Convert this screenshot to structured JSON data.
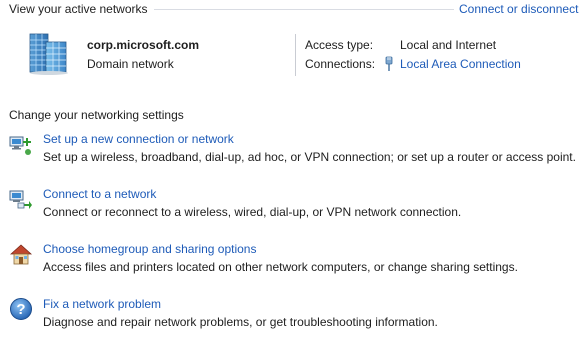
{
  "active_networks": {
    "heading": "View your active networks",
    "connect_link": "Connect or disconnect",
    "network": {
      "name": "corp.microsoft.com",
      "type": "Domain network",
      "icon": "building-network-icon"
    },
    "access_type_label": "Access type:",
    "access_type_value": "Local and Internet",
    "connections_label": "Connections:",
    "connection_link": "Local Area Connection",
    "connection_icon": "ethernet-plug-icon"
  },
  "settings": {
    "heading": "Change your networking settings",
    "tasks": [
      {
        "title": "Set up a new connection or network",
        "description": "Set up a wireless, broadband, dial-up, ad hoc, or VPN connection; or set up a router or access point.",
        "icon": "new-connection-icon"
      },
      {
        "title": "Connect to a network",
        "description": "Connect or reconnect to a wireless, wired, dial-up, or VPN network connection.",
        "icon": "connect-network-icon"
      },
      {
        "title": "Choose homegroup and sharing options",
        "description": "Access files and printers located on other network computers, or change sharing settings.",
        "icon": "homegroup-icon"
      },
      {
        "title": "Fix a network problem",
        "description": "Diagnose and repair network problems, or get troubleshooting information.",
        "icon": "help-icon"
      }
    ]
  },
  "colors": {
    "link": "#1e5bb8",
    "text": "#1e1e1e",
    "rule": "#d9dce3"
  }
}
